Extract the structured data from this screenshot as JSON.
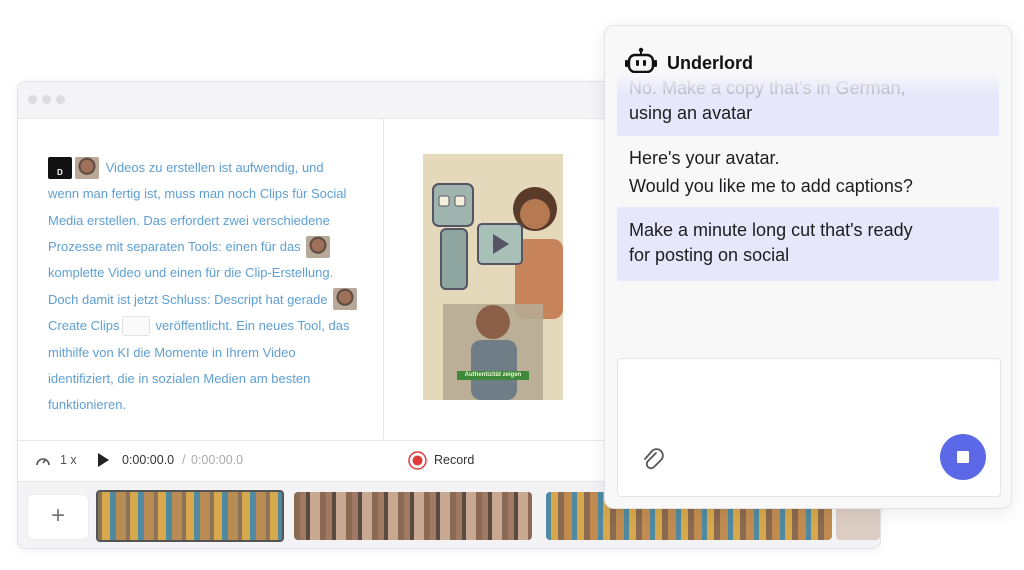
{
  "editor": {
    "script_lines": [
      "Videos zu erstellen ist aufwendig, und",
      "wenn man fertig ist, muss man noch Clips für Social",
      "Media erstellen. Das erfordert zwei verschiedene",
      "Prozesse mit separaten Tools: einen für das",
      "komplette Video und einen für die Clip-Erstellung.",
      "Doch damit ist jetzt Schluss: Descript hat gerade",
      "Create Clips",
      "veröffentlicht. Ein neues Tool, das",
      "mithilfe von KI die Momente in Ihrem Video",
      "identifiziert, die in sozialen Medien am besten",
      "funktionieren."
    ],
    "preview_caption": "Authentizität zeigen",
    "toolbar": {
      "speed": "1 x",
      "time_current": "0:00:00.0",
      "time_separator": "/",
      "time_total": "0:00:00.0",
      "record_label": "Record"
    },
    "timeline": {
      "add_label": "+"
    }
  },
  "underlord": {
    "title": "Underlord",
    "messages": [
      {
        "role": "user",
        "text_faded": "No. Make a copy that's in German,",
        "text": "using an avatar"
      },
      {
        "role": "assistant",
        "lines": [
          "Here's your avatar.",
          "Would you like me to add captions?"
        ]
      },
      {
        "role": "user",
        "lines": [
          "Make a minute long cut that's ready",
          "for posting on social"
        ]
      }
    ]
  },
  "colors": {
    "accent": "#5b68e8",
    "user_bubble": "#e6e7fb",
    "script_text": "#5e9fd3",
    "record": "#e03c3c"
  }
}
